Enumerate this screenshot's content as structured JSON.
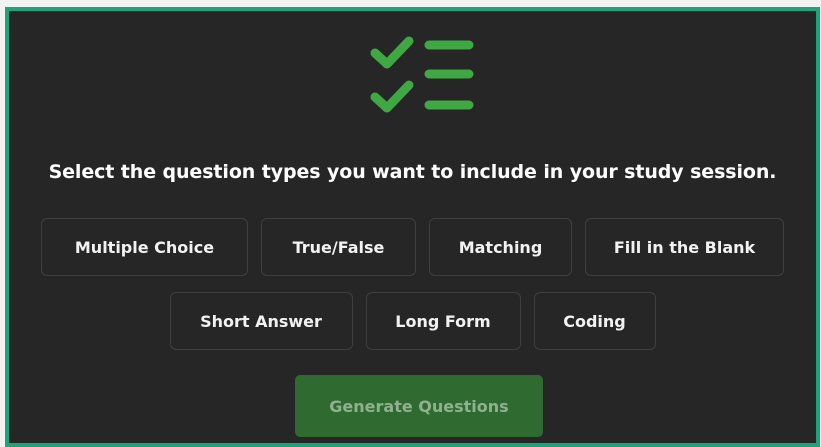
{
  "header": {
    "icon": "checklist-icon",
    "icon_color": "#3fa842"
  },
  "prompt": "Select the question types you want to include in your study session.",
  "question_types": {
    "row1": [
      "Multiple Choice",
      "True/False",
      "Matching",
      "Fill in the Blank"
    ],
    "row2": [
      "Short Answer",
      "Long Form",
      "Coding"
    ]
  },
  "generate_button": {
    "label": "Generate Questions",
    "state": "disabled"
  },
  "colors": {
    "frame_border": "#1ea37a",
    "panel_bg": "#262626",
    "button_bg": "#2f6b31"
  }
}
